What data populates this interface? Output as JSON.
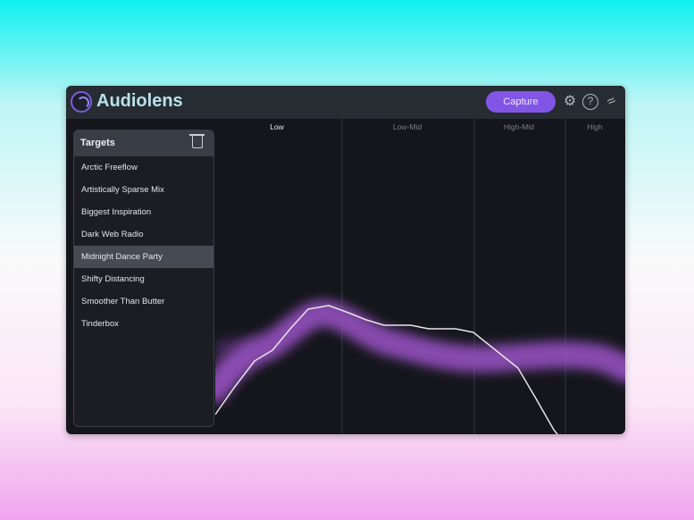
{
  "app": {
    "title": "Audiolens",
    "capture_label": "Capture"
  },
  "icons": {
    "logo": "audiolens-logo",
    "settings": "gear-icon",
    "help": "question-icon",
    "extra": "waveform-icon",
    "trash": "trash-icon"
  },
  "colors": {
    "accent": "#8155e6",
    "band": "#9b52c8",
    "curve": "#e8e8e8"
  },
  "sidebar": {
    "title": "Targets",
    "selected": "Midnight Dance Party",
    "items": [
      {
        "label": "Arctic Freeflow"
      },
      {
        "label": "Artistically Sparse Mix"
      },
      {
        "label": "Biggest Inspiration"
      },
      {
        "label": "Dark Web Radio"
      },
      {
        "label": "Midnight Dance Party"
      },
      {
        "label": "Shifty Distancing"
      },
      {
        "label": "Smoother Than Butter"
      },
      {
        "label": "Tinderbox"
      }
    ]
  },
  "bands": [
    {
      "label": "Low",
      "active": true
    },
    {
      "label": "Low-Mid",
      "active": false
    },
    {
      "label": "High-Mid",
      "active": false
    },
    {
      "label": "High",
      "active": false
    }
  ]
}
